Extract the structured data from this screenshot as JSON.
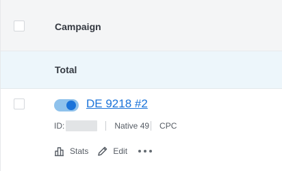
{
  "header": {
    "campaign_label": "Campaign"
  },
  "total_row": {
    "label": "Total"
  },
  "campaign_row": {
    "name": "DE 9218 #2",
    "toggle_on": true,
    "id_label": "ID:",
    "network": "Native 49",
    "model": "CPC",
    "actions": {
      "stats": "Stats",
      "edit": "Edit"
    }
  },
  "colors": {
    "link": "#1a73d9",
    "toggle_track": "#8fc2ec",
    "toggle_knob": "#1a73d9",
    "header_bg": "#f4f5f6",
    "total_bg": "#edf6fb"
  },
  "icons": {
    "stats": "bar-chart-icon",
    "edit": "pencil-icon",
    "more": "more-dots-icon"
  }
}
